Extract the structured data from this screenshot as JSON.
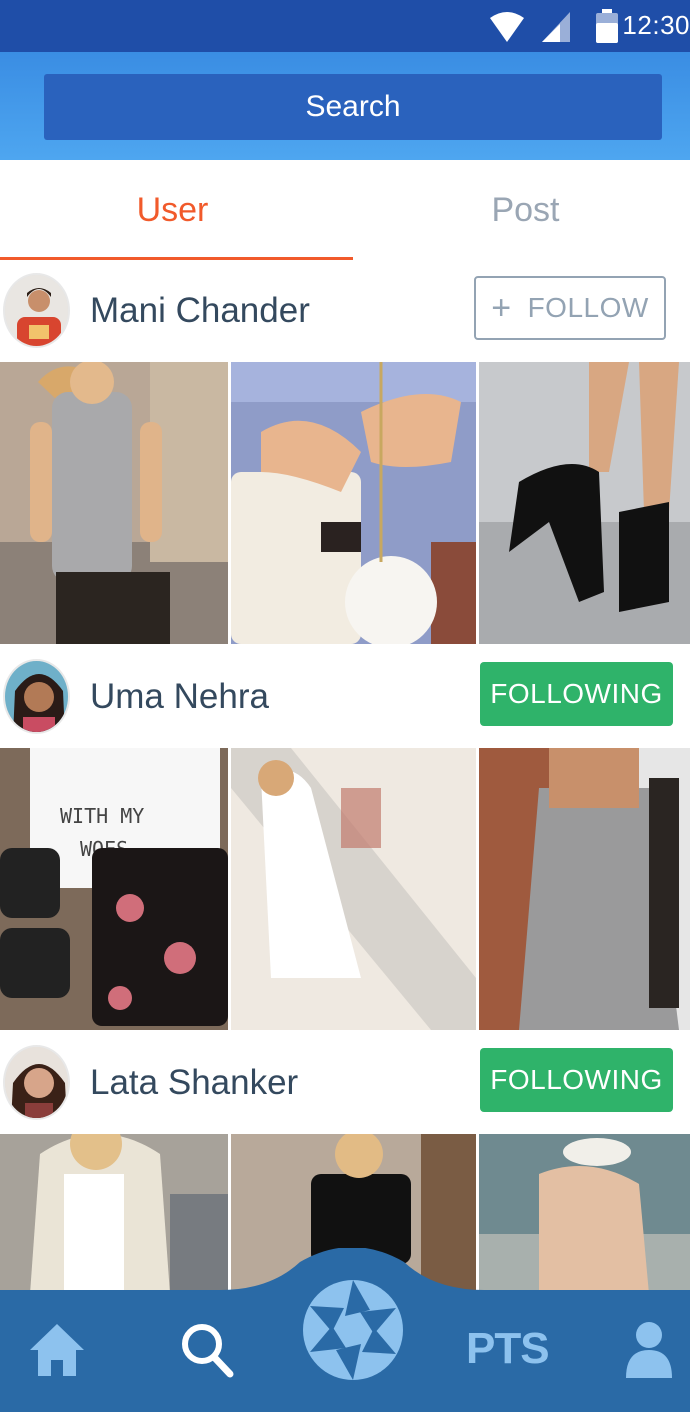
{
  "status_bar": {
    "time": "12:30"
  },
  "search": {
    "label": "Search"
  },
  "tabs": [
    {
      "label": "User",
      "active": true
    },
    {
      "label": "Post",
      "active": false
    }
  ],
  "users": [
    {
      "name": "Mani Chander",
      "button": "FOLLOW",
      "button_plus": "+",
      "following": false
    },
    {
      "name": "Uma Nehra",
      "button": "FOLLOWING",
      "following": true
    },
    {
      "name": "Lata Shanker",
      "button": "FOLLOWING",
      "following": true
    }
  ],
  "bottom_nav": {
    "items": [
      "home-icon",
      "search-icon",
      "camera-shutter-icon",
      "PTS",
      "profile-icon"
    ],
    "pts_label": "PTS"
  },
  "colors": {
    "accent": "#f15a2b",
    "status_bar": "#1f4ea8",
    "header": "#4ea6f0",
    "following": "#2fb36a",
    "nav": "#2a6aa6",
    "nav_icons": "#8dc2ee"
  }
}
